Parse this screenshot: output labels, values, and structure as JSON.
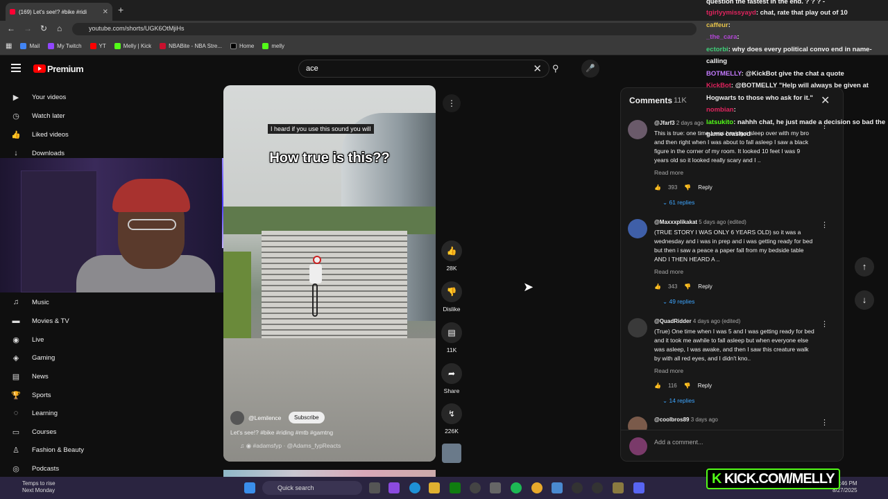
{
  "browser": {
    "tab_title": "(169) Let's see!? #bike #ridi",
    "url": "youtube.com/shorts/UGK6OtMjiHs",
    "bookmarks": [
      "Mail",
      "My Twitch",
      "YT",
      "Melly | Kick",
      "NBABite - NBA Stre...",
      "Home",
      "melly"
    ]
  },
  "youtube": {
    "brand": "Premium",
    "search_value": "ace"
  },
  "sidebar": {
    "items": [
      {
        "label": "Your videos",
        "icon": "video-icon"
      },
      {
        "label": "Watch later",
        "icon": "clock-icon"
      },
      {
        "label": "Liked videos",
        "icon": "thumb-up-icon"
      },
      {
        "label": "Downloads",
        "icon": "download-icon"
      },
      {
        "label": "Music",
        "icon": "music-icon"
      },
      {
        "label": "Movies & TV",
        "icon": "film-icon"
      },
      {
        "label": "Live",
        "icon": "live-icon"
      },
      {
        "label": "Gaming",
        "icon": "gaming-icon"
      },
      {
        "label": "News",
        "icon": "news-icon"
      },
      {
        "label": "Sports",
        "icon": "trophy-icon"
      },
      {
        "label": "Learning",
        "icon": "bulb-icon"
      },
      {
        "label": "Courses",
        "icon": "courses-icon"
      },
      {
        "label": "Fashion & Beauty",
        "icon": "hanger-icon"
      },
      {
        "label": "Podcasts",
        "icon": "podcast-icon"
      }
    ]
  },
  "video": {
    "caption_small": "I heard if you use this sound you will",
    "caption_big": "How true is this??",
    "channel": "@Lemilence",
    "subscribe": "Subscribe",
    "description": "Let's see!? #bike #riding #mtb #gamtng",
    "sound": "#adamsfyp · @Adams_fypReacts"
  },
  "actions": {
    "likes": "28K",
    "dislike": "Dislike",
    "comments": "11K",
    "share": "Share",
    "remix": "226K"
  },
  "comments_panel": {
    "title": "Comments",
    "count": "11K",
    "read_more": "Read more",
    "reply": "Reply",
    "add_placeholder": "Add a comment...",
    "items": [
      {
        "user": "@Jfarf3",
        "time": "2 days ago",
        "text": "This is true: one time I was having a sleep over with my bro and then right when I was about to fall asleep I saw a black figure in the corner of my room. It looked 10 feet I was 9 years old so it looked really scary and I ..",
        "likes": "393",
        "replies": "61 replies"
      },
      {
        "user": "@Maxxxplikakat",
        "time": "5 days ago (edited)",
        "text": "(TRUE STORY I WAS ONLY 6 YEARS OLD) so it was a wednesday and i was in prep and i was getting ready for bed but then i saw a peace a paper fall from my bedside table AND I THEN HEARD A ..",
        "likes": "343",
        "replies": "49 replies"
      },
      {
        "user": "@QuadRidder",
        "time": "4 days ago (edited)",
        "text": "(True) One time when I was 5 and I was getting ready for bed and it took me awhile to fall asleep but when everyone else was asleep, I was awake, and then I saw this creature walk by with all red eyes, and I didn't kno..",
        "likes": "116",
        "replies": "14 replies"
      },
      {
        "user": "@coolbros89",
        "time": "3 days ago"
      }
    ]
  },
  "chat": [
    {
      "user": "",
      "text": "question the fastest in the end. ? ? ? -",
      "color": "#ffffff"
    },
    {
      "user": "tgirlyymissyayd",
      "text": ": chat, rate that play out of 10",
      "color": "#e0245e"
    },
    {
      "user": "caffeur",
      "text": ":",
      "color": "#e6c34a"
    },
    {
      "user": "_the_cara",
      "text": ":",
      "color": "#b347d6"
    },
    {
      "user": "ectorbi",
      "text": ": why does every political convo end in name-calling",
      "color": "#3fd17a"
    },
    {
      "user": "BOTMELLY",
      "text": ": @KickBot give the chat a quote",
      "color": "#c47bff"
    },
    {
      "user": "KickBot",
      "text": ": @BOTMELLY \"Help will always be given at Hogwarts to those who ask for it.\"",
      "color": "#e0245e"
    },
    {
      "user": "nombian",
      "text": ":",
      "color": "#e0245e"
    },
    {
      "user": "latsukito",
      "text": ": nahhh chat, he just made a decision so bad the game crashed",
      "color": "#53fc18"
    }
  ],
  "taskbar": {
    "weather_line1": "Temps to rise",
    "weather_line2": "Next Monday",
    "search": "Quick search",
    "time": "1:46 PM",
    "date": "8/27/2025"
  },
  "overlay": {
    "kick_prefix": "K",
    "kick_text": "KICK.COM/MELLY"
  },
  "colors": {
    "accent_blue": "#3ea6ff",
    "yt_red": "#ff0000",
    "kick_green": "#53fc18"
  }
}
